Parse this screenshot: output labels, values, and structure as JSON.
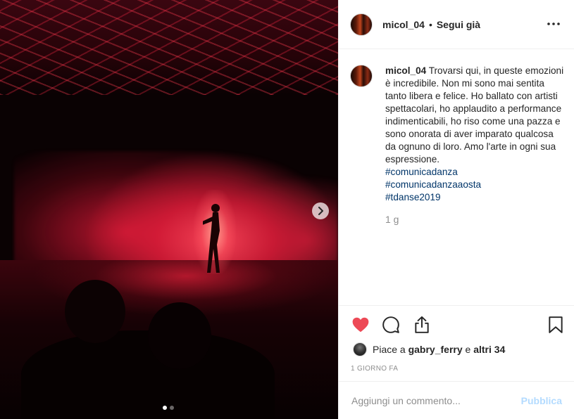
{
  "post": {
    "username": "micol_04",
    "separator": "•",
    "follow_status": "Segui già",
    "more_icon": "more-options-icon"
  },
  "caption": {
    "username": "micol_04",
    "text": "Trovarsi qui, in queste emozioni è incredibile. Non mi sono mai sentita tanto libera e felice. Ho ballato con artisti spettacolari, ho applaudito a performance indimenticabili, ho riso come una pazza e sono onorata di aver imparato qualcosa da ognuno di loro. Amo l'arte in ogni sua espressione.",
    "hashtags": [
      "#comunicadanza",
      "#comunicadanzaaosta",
      "#tdanse2019"
    ],
    "time_ago": "1 g"
  },
  "actions": {
    "like_icon": "heart-filled-icon",
    "comment_icon": "comment-icon",
    "share_icon": "share-icon",
    "save_icon": "bookmark-icon",
    "like_color": "#ed4956"
  },
  "likes": {
    "prefix": "Piace a",
    "user": "gabry_ferry",
    "joiner": "e",
    "others": "altri 34"
  },
  "date": "1 giorno fa",
  "comment": {
    "placeholder": "Aggiungi un commento...",
    "value": "",
    "post_label": "Pubblica"
  },
  "carousel": {
    "current": 1,
    "total": 2,
    "next_icon": "chevron-right-icon"
  }
}
